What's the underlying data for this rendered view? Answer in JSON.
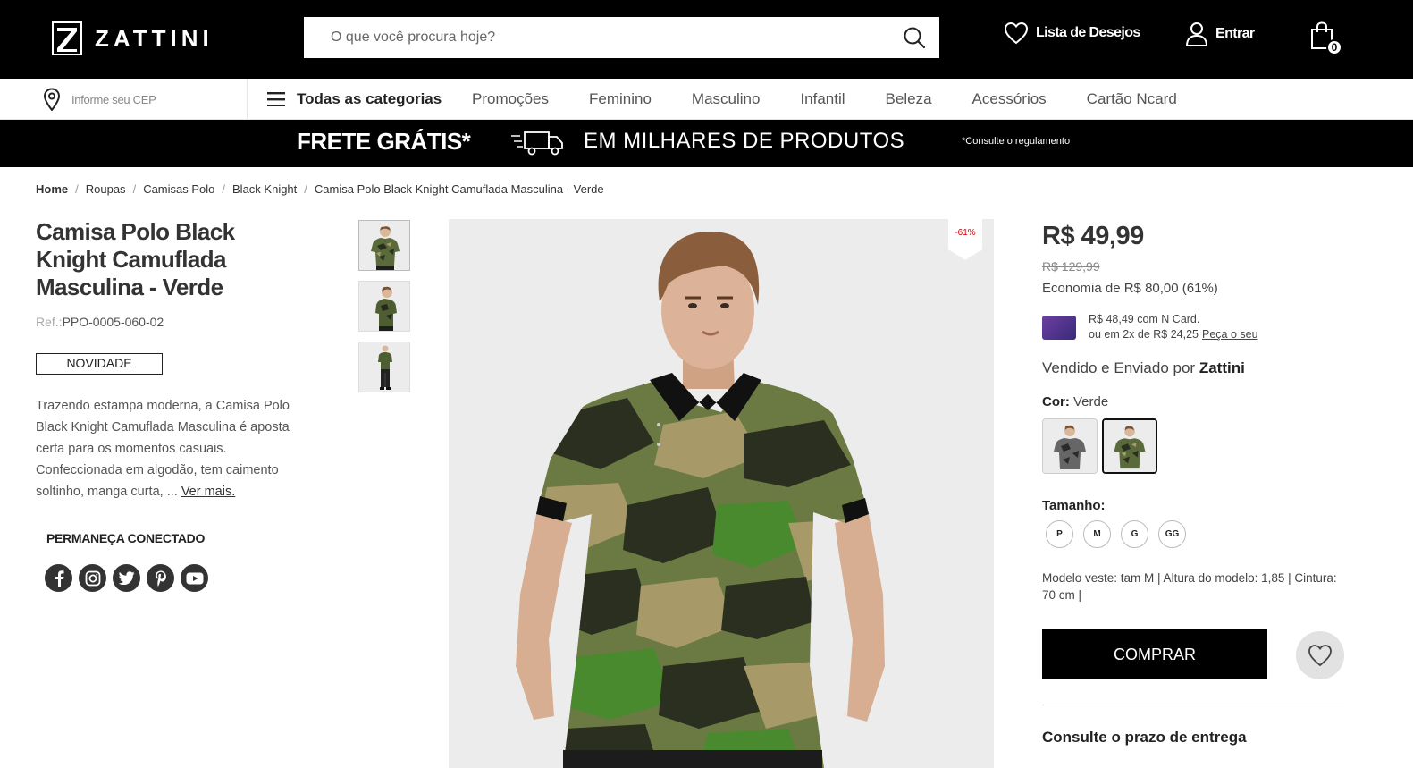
{
  "header": {
    "logo_text": "ZATTINI",
    "search_placeholder": "O que você procura hoje?",
    "wishlist_label": "Lista de Desejos",
    "login_label": "Entrar",
    "cart_count": "0"
  },
  "nav": {
    "cep_placeholder": "Informe seu CEP",
    "all_categories": "Todas as categorias",
    "links": [
      "Promoções",
      "Feminino",
      "Masculino",
      "Infantil",
      "Beleza",
      "Acessórios",
      "Cartão Ncard"
    ]
  },
  "banner": {
    "main": "FRETE GRÁTIS*",
    "secondary": "EM MILHARES DE PRODUTOS",
    "note": "*Consulte o regulamento"
  },
  "breadcrumb": [
    "Home",
    "Roupas",
    "Camisas Polo",
    "Black Knight",
    "Camisa Polo Black Knight Camuflada Masculina - Verde"
  ],
  "product": {
    "title": "Camisa Polo Black Knight Camuflada Masculina - Verde",
    "ref_label": "Ref.:",
    "ref": "PPO-0005-060-02",
    "badge": "NOVIDADE",
    "description": "Trazendo estampa moderna, a Camisa Polo Black Knight Camuflada Masculina é aposta certa para os momentos casuais. Confeccionada em algodão, tem caimento soltinho, manga curta, ...",
    "see_more": "Ver mais.",
    "discount_tag": "-61%"
  },
  "social": {
    "title": "PERMANEÇA CONECTADO",
    "icons": [
      "facebook-icon",
      "instagram-icon",
      "twitter-icon",
      "pinterest-icon",
      "youtube-icon"
    ]
  },
  "pricing": {
    "price": "R$ 49,99",
    "old_price": "R$ 129,99",
    "economy": "Economia de R$ 80,00 (61%)",
    "ncard_line1": "R$ 48,49 com N Card.",
    "ncard_line2": "ou em 2x de R$ 24,25",
    "ncard_link": "Peça o seu",
    "seller_prefix": "Vendido e Enviado por",
    "seller_name": "Zattini"
  },
  "options": {
    "color_label": "Cor:",
    "color_value": "Verde",
    "size_label": "Tamanho:",
    "sizes": [
      "P",
      "M",
      "G",
      "GG"
    ],
    "model_info": "Modelo veste: tam M | Altura do modelo: 1,85 | Cintura: 70 cm |"
  },
  "actions": {
    "buy": "COMPRAR",
    "delivery_title": "Consulte o prazo de entrega"
  },
  "colors": {
    "header_bg": "#000000",
    "buy_bg": "#000000",
    "discount": "#cc0000"
  }
}
